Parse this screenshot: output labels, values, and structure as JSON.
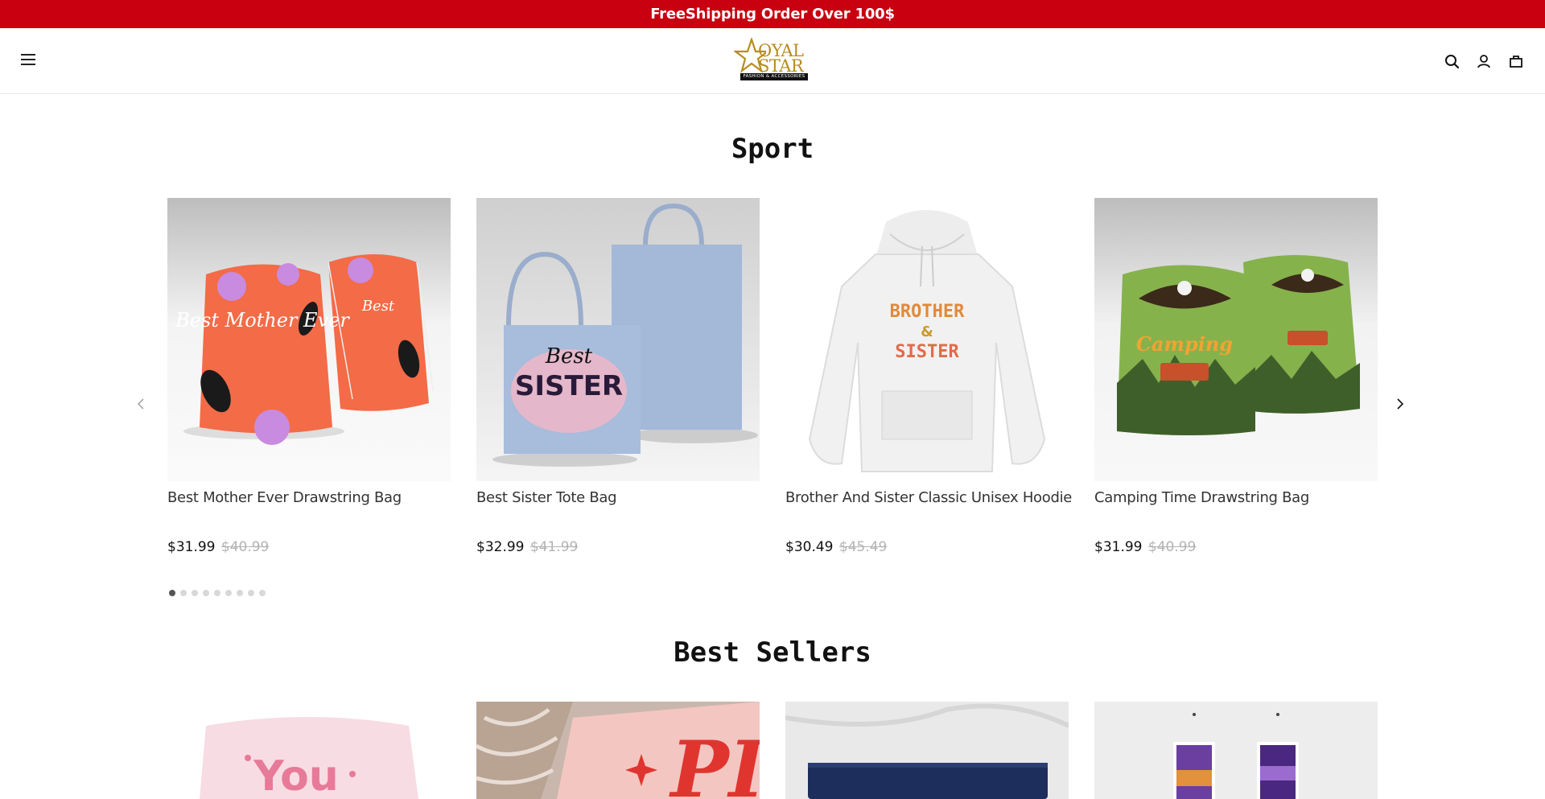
{
  "announcement": {
    "text": "FreeShipping Order Over 100$"
  },
  "header": {
    "logo": {
      "brand_line1": "OYAL",
      "brand_line2": "STAR",
      "tagline": "FASHION & ACCESSORIES"
    },
    "icons": [
      "menu-icon",
      "search-icon",
      "account-icon",
      "cart-icon"
    ]
  },
  "sport": {
    "title": "Sport",
    "products": [
      {
        "title": "Best Mother Ever Drawstring Bag",
        "price": "$31.99",
        "compare_price": "$40.99"
      },
      {
        "title": "Best Sister Tote Bag",
        "price": "$32.99",
        "compare_price": "$41.99"
      },
      {
        "title": "Brother And Sister Classic Unisex Hoodie",
        "price": "$30.49",
        "compare_price": "$45.49"
      },
      {
        "title": "Camping Time Drawstring Bag",
        "price": "$31.99",
        "compare_price": "$40.99"
      }
    ],
    "image_text": {
      "bag1": "Best Mother Ever",
      "tote_best": "Best",
      "tote_sister": "SISTER",
      "hoodie_brother": "BROTHER",
      "hoodie_amp": "&",
      "hoodie_sister": "SISTER",
      "camping": "Camping"
    },
    "pagination": {
      "total": 9,
      "active": 1
    }
  },
  "best_sellers": {
    "title": "Best Sellers",
    "image_text": {
      "pillow1": "You",
      "pillow2": "PI"
    }
  },
  "colors": {
    "announcement_bg": "#c8000f",
    "logo_gold": "#b88c1e"
  }
}
